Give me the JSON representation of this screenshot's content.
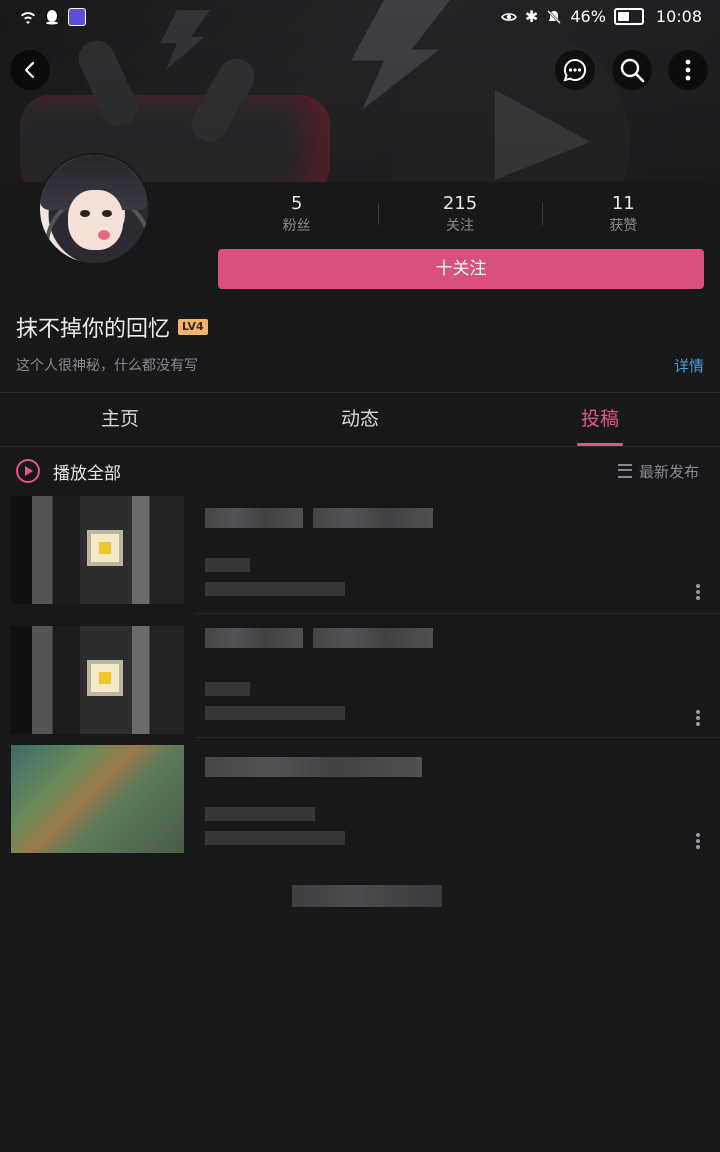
{
  "status_bar": {
    "battery_percent": "46%",
    "time": "10:08"
  },
  "nav": {
    "back_icon": "back-arrow-icon",
    "message_icon": "chat-bubble-icon",
    "search_icon": "search-icon",
    "more_icon": "more-vertical-icon"
  },
  "profile": {
    "stats": [
      {
        "value": "5",
        "label": "粉丝"
      },
      {
        "value": "215",
        "label": "关注"
      },
      {
        "value": "11",
        "label": "获赞"
      }
    ],
    "follow_label": "十关注",
    "username": "抹不掉你的回忆",
    "level_badge": "LV4",
    "bio": "这个人很神秘，什么都没有写",
    "details_label": "详情"
  },
  "tabs": [
    {
      "label": "主页",
      "active": false
    },
    {
      "label": "动态",
      "active": false
    },
    {
      "label": "投稿",
      "active": true
    }
  ],
  "list_header": {
    "play_all_label": "播放全部",
    "sort_label": "最新发布"
  },
  "colors": {
    "accent": "#e25588",
    "follow_button": "#d94f7e",
    "link": "#3f9fd6",
    "background": "#17181a"
  }
}
